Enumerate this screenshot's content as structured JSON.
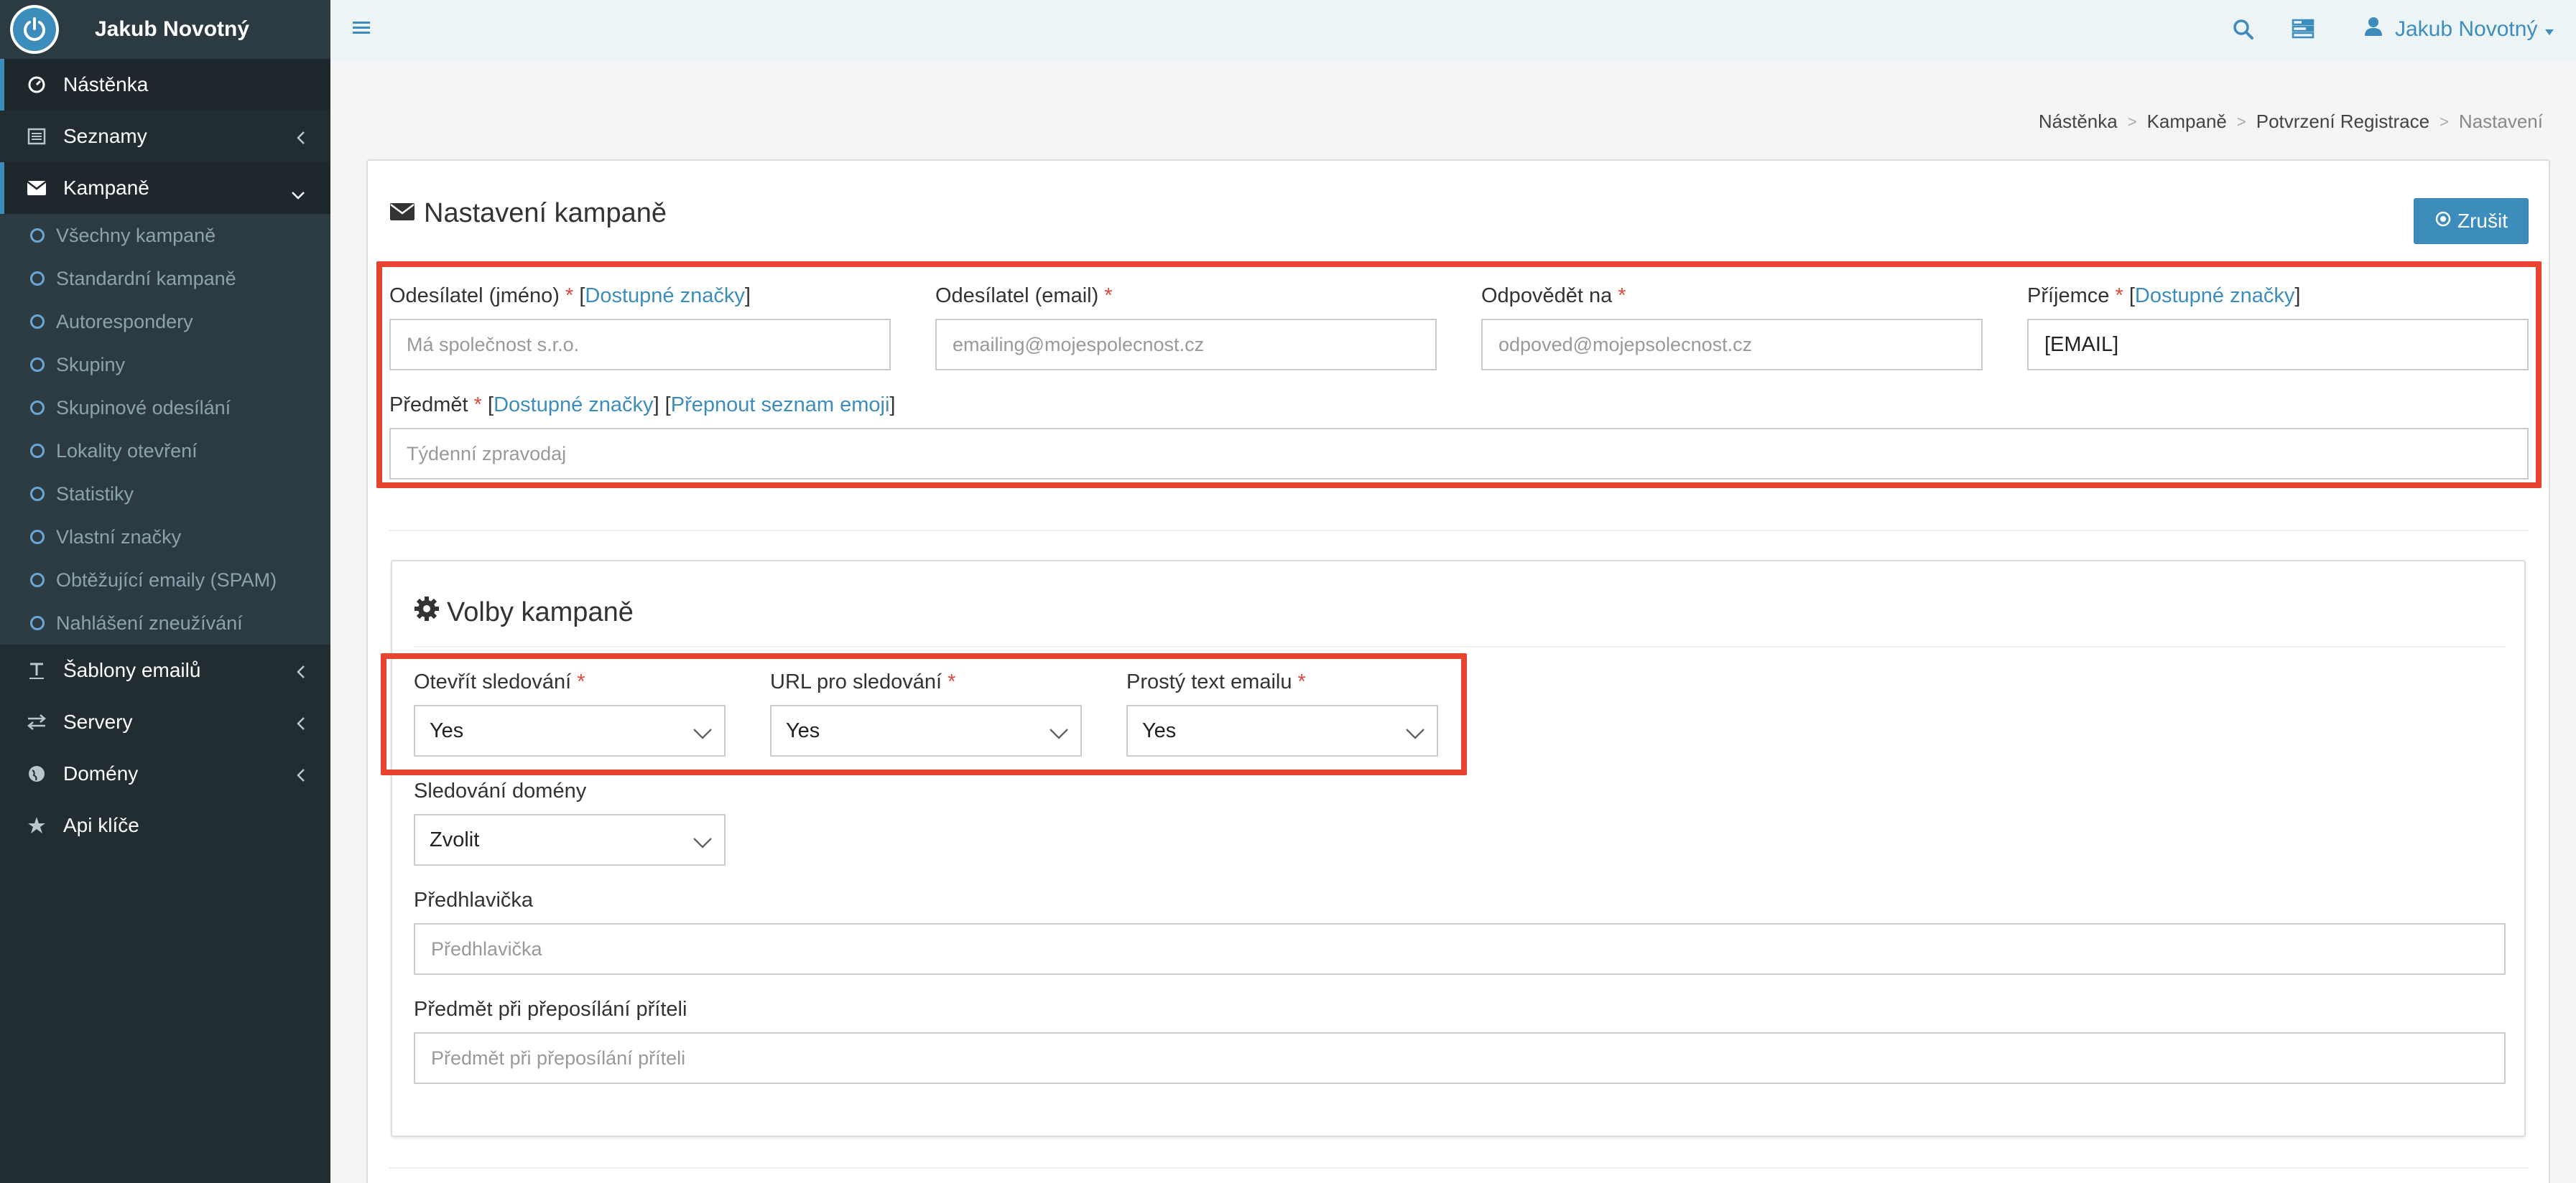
{
  "app": {
    "brand_name": "Jakub Novotný"
  },
  "sidebar": {
    "items": [
      {
        "label": "Nástěnka",
        "icon": "dashboard-icon"
      },
      {
        "label": "Seznamy",
        "icon": "list-icon"
      },
      {
        "label": "Kampaně",
        "icon": "envelope-icon"
      },
      {
        "label": "Šablony emailů",
        "icon": "text-icon"
      },
      {
        "label": "Servery",
        "icon": "exchange-icon"
      },
      {
        "label": "Domény",
        "icon": "globe-icon"
      },
      {
        "label": "Api klíče",
        "icon": "star-icon"
      }
    ],
    "campaign_sub": [
      "Všechny kampaně",
      "Standardní kampaně",
      "Autorespondery",
      "Skupiny",
      "Skupinové odesílání",
      "Lokality otevření",
      "Statistiky",
      "Vlastní značky",
      "Obtěžující emaily (SPAM)",
      "Nahlášení zneužívání"
    ]
  },
  "topbar": {
    "user_name": "Jakub Novotný"
  },
  "breadcrumb": [
    "Nástěnka",
    "Kampaně",
    "Potvrzení Registrace",
    "Nastavení"
  ],
  "card": {
    "title": "Nastavení kampaně",
    "cancel_label": "Zrušit"
  },
  "form": {
    "sender_name": {
      "label": "Odesílatel (jméno)",
      "req": "*",
      "tags": "Dostupné značky",
      "placeholder": "Má společnost s.r.o."
    },
    "sender_email": {
      "label": "Odesílatel (email)",
      "req": "*",
      "placeholder": "emailing@mojespolecnost.cz"
    },
    "reply_to": {
      "label": "Odpovědět na",
      "req": "*",
      "placeholder": "odpoved@mojepsolecnost.cz"
    },
    "recipient": {
      "label": "Příjemce",
      "req": "*",
      "tags": "Dostupné značky",
      "value": "[EMAIL]"
    },
    "subject": {
      "label": "Předmět",
      "req": "*",
      "tags": "Dostupné značky",
      "emoji": "Přepnout seznam emoji",
      "placeholder": "Týdenní zpravodaj"
    }
  },
  "options": {
    "title": "Volby kampaně",
    "open_tracking": {
      "label": "Otevřít sledování",
      "req": "*",
      "value": "Yes"
    },
    "url_tracking": {
      "label": "URL pro sledování",
      "req": "*",
      "value": "Yes"
    },
    "plain_text": {
      "label": "Prostý text emailu",
      "req": "*",
      "value": "Yes"
    },
    "domain_tracking": {
      "label": "Sledování domény",
      "value": "Zvolit"
    },
    "preheader": {
      "label": "Předhlavička",
      "placeholder": "Předhlavička"
    },
    "forward_subject": {
      "label": "Předmět při přeposílání příteli",
      "placeholder": "Předmět při přeposílání příteli"
    }
  },
  "colors": {
    "accent": "#3c8dbc",
    "sidebar_bg": "#222d32",
    "highlight": "#e8432e",
    "required": "#dd4b39"
  }
}
